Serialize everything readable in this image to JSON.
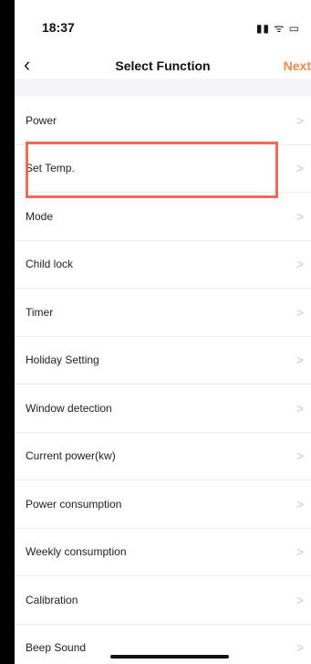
{
  "status": {
    "time": "18:37",
    "icons": "▮▮ ᯤ ▭"
  },
  "nav": {
    "back": "‹",
    "title": "Select Function",
    "next": "Next"
  },
  "rows": [
    {
      "label": "Power"
    },
    {
      "label": "Set Temp."
    },
    {
      "label": "Mode"
    },
    {
      "label": "Child lock"
    },
    {
      "label": "Timer"
    },
    {
      "label": "Holiday Setting"
    },
    {
      "label": "Window detection"
    },
    {
      "label": "Current power(kw)"
    },
    {
      "label": "Power consumption"
    },
    {
      "label": "Weekly consumption"
    },
    {
      "label": "Calibration"
    },
    {
      "label": "Beep Sound"
    }
  ],
  "chevron": ">",
  "accent_color": "#f0894b",
  "highlight_color": "#ec6b5a"
}
